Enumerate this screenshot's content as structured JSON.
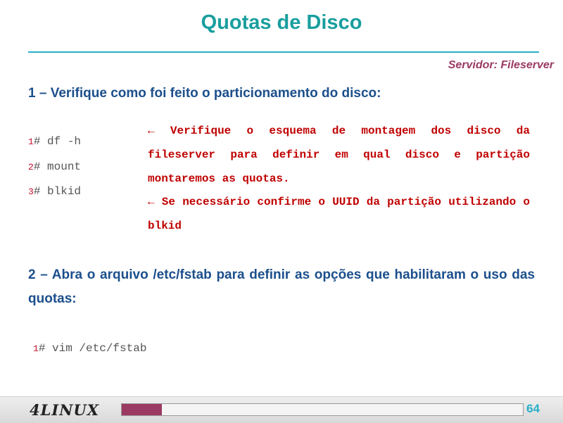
{
  "slide": {
    "title": "Quotas de Disco",
    "server_label": "Servidor: Fileserver"
  },
  "step1": {
    "text": "1 – Verifique como foi feito o particionamento do disco:",
    "commands": [
      {
        "num": "1",
        "text": "# df -h"
      },
      {
        "num": "2",
        "text": "# mount"
      },
      {
        "num": "3",
        "text": "# blkid"
      }
    ],
    "notes": [
      "← Verifique o esquema de montagem dos disco da fileserver para definir em qual disco e partição montaremos as quotas.",
      "← Se necessário confirme o UUID da partição utilizando o blkid"
    ]
  },
  "step2": {
    "text": "2 – Abra o arquivo /etc/fstab para definir as opções que habilitaram o uso das quotas:",
    "commands": [
      {
        "num": "1",
        "text": "# vim /etc/fstab"
      }
    ]
  },
  "footer": {
    "logo": "4LINUX",
    "page_number": "64",
    "progress_fraction": 0.1,
    "progress_color": "#9b3a63"
  }
}
